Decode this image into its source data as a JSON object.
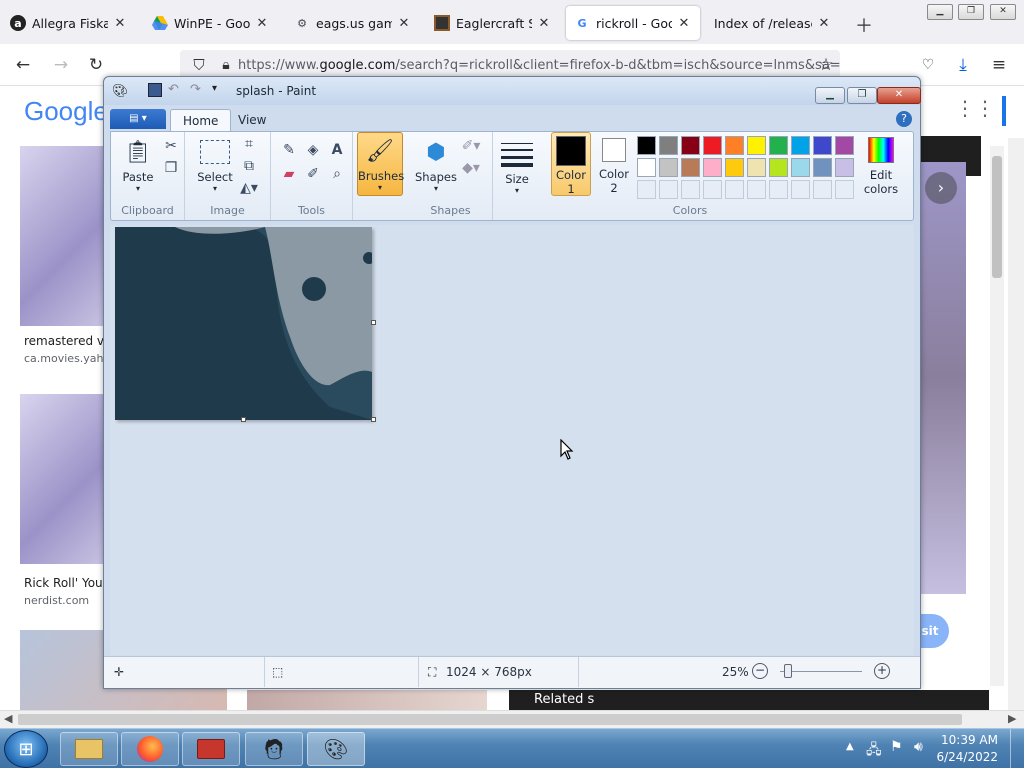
{
  "browser": {
    "tabs": [
      {
        "label": "Allegra Fiskal",
        "icon": "allegra-icon"
      },
      {
        "label": "WinPE - Google",
        "icon": "google-drive-icon"
      },
      {
        "label": "eags.us games",
        "icon": "games-icon"
      },
      {
        "label": "Eaglercraft Sing",
        "icon": "eaglercraft-icon"
      },
      {
        "label": "rickroll - Google",
        "icon": "google-icon",
        "active": true
      },
      {
        "label": "Index of /releases/g",
        "icon": "none"
      }
    ],
    "url_prefix": "https://www.",
    "url_domain": "google.com",
    "url_rest": "/search?q=rickroll&client=firefox-b-d&tbm=isch&source=lnms&sa="
  },
  "google": {
    "logo": "Google",
    "results": [
      {
        "caption": "remastered ve",
        "source": "ca.movies.yahoo"
      },
      {
        "caption": "Rick Roll' Your",
        "source": "nerdist.com"
      }
    ],
    "side_button": "sit",
    "related": "Related s"
  },
  "paint": {
    "title": "splash - Paint",
    "tabs": {
      "home": "Home",
      "view": "View"
    },
    "groups": {
      "clipboard": "Clipboard",
      "image": "Image",
      "tools": "Tools",
      "shapes": "Shapes",
      "colors": "Colors"
    },
    "buttons": {
      "paste": "Paste",
      "select": "Select",
      "brushes": "Brushes",
      "shapes": "Shapes",
      "size": "Size",
      "color1": "Color",
      "color1_num": "1",
      "color2": "Color",
      "color2_num": "2",
      "edit_colors": "Edit",
      "edit_colors2": "colors"
    },
    "palette_row1": [
      "#000000",
      "#7f7f7f",
      "#880015",
      "#ed1c24",
      "#ff7f27",
      "#fff200",
      "#22b14c",
      "#00a2e8",
      "#3f48cc",
      "#a349a4"
    ],
    "palette_row2": [
      "#ffffff",
      "#c3c3c3",
      "#b97a57",
      "#ffaec9",
      "#ffc90e",
      "#efe4b0",
      "#b5e61d",
      "#99d9ea",
      "#7092be",
      "#c8bfe7"
    ],
    "color1_value": "#000000",
    "color2_value": "#ffffff",
    "status": {
      "dimensions": "1024 × 768px",
      "zoom": "25%"
    }
  },
  "taskbar": {
    "time": "10:39 AM",
    "date": "6/24/2022"
  }
}
